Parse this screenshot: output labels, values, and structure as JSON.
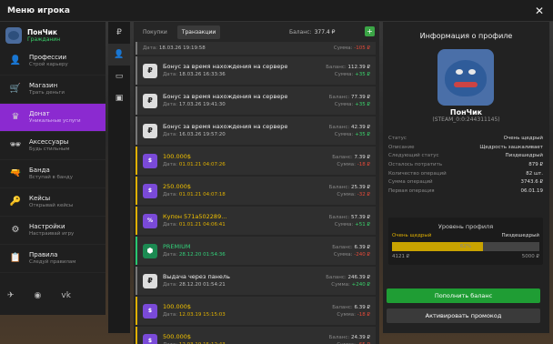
{
  "window": {
    "title": "Меню игрока",
    "close_symbol": "✕"
  },
  "player": {
    "name": "ПонЧик",
    "role": "Гражданин"
  },
  "sidebar": {
    "items": [
      {
        "icon": "person-icon",
        "glyph": "👤",
        "title": "Профессии",
        "subtitle": "Строй карьеру"
      },
      {
        "icon": "shop-icon",
        "glyph": "🛒",
        "title": "Магазин",
        "subtitle": "Трать деньги"
      },
      {
        "icon": "crown-icon",
        "glyph": "♛",
        "title": "Донат",
        "subtitle": "Уникальные услуги"
      },
      {
        "icon": "accessories-icon",
        "glyph": "🕶",
        "title": "Аксессуары",
        "subtitle": "Будь стильным"
      },
      {
        "icon": "gun-icon",
        "glyph": "🔫",
        "title": "Банда",
        "subtitle": "Вступай в банду"
      },
      {
        "icon": "key-icon",
        "glyph": "🔑",
        "title": "Кейсы",
        "subtitle": "Открывай кейсы"
      },
      {
        "icon": "settings-icon",
        "glyph": "⚙",
        "title": "Настройки",
        "subtitle": "Настраивай игру"
      },
      {
        "icon": "rules-icon",
        "glyph": "📋",
        "title": "Правила",
        "subtitle": "Следуй правилам"
      }
    ],
    "socials": [
      {
        "icon": "telegram-icon",
        "glyph": "✈"
      },
      {
        "icon": "discord-icon",
        "glyph": "◉"
      },
      {
        "icon": "vk-icon",
        "glyph": "vk"
      }
    ]
  },
  "icon_column": [
    {
      "icon": "ruble-icon",
      "glyph": "₽"
    },
    {
      "icon": "user-icon",
      "glyph": "👤"
    },
    {
      "icon": "car-icon",
      "glyph": "▭"
    },
    {
      "icon": "box-icon",
      "glyph": "▣"
    }
  ],
  "tabs": [
    "Покупки",
    "Транзакции"
  ],
  "balance": {
    "label": "Баланс:",
    "value": "377.4 ₽",
    "add_symbol": "+"
  },
  "transactions": [
    {
      "kind": "normal",
      "glyph": "₽",
      "title": "",
      "date": "18.03.26 19:19:58",
      "balance": "",
      "sum": "-105 ₽",
      "sign": "neg"
    },
    {
      "kind": "normal",
      "glyph": "₽",
      "title": "Бонус за время нахождения на сервере",
      "date": "18.03.26 16:33:36",
      "balance": "112.39 ₽",
      "sum": "+35 ₽",
      "sign": "pos"
    },
    {
      "kind": "normal",
      "glyph": "₽",
      "title": "Бонус за время нахождения на сервере",
      "date": "17.03.26 19:41:30",
      "balance": "77.39 ₽",
      "sum": "+35 ₽",
      "sign": "pos"
    },
    {
      "kind": "normal",
      "glyph": "₽",
      "title": "Бонус за время нахождения на сервере",
      "date": "16.03.26 19:57:20",
      "balance": "42.39 ₽",
      "sum": "+35 ₽",
      "sign": "pos"
    },
    {
      "kind": "gold",
      "glyph": "$",
      "title": "100.000$",
      "date": "01.01.21 04:07:26",
      "balance": "7.39 ₽",
      "sum": "-18 ₽",
      "sign": "neg"
    },
    {
      "kind": "gold",
      "glyph": "$",
      "title": "250.000$",
      "date": "01.01.21 04:07:18",
      "balance": "25.39 ₽",
      "sum": "-32 ₽",
      "sign": "neg"
    },
    {
      "kind": "gold",
      "glyph": "%",
      "title": "Купон 571a502289...",
      "date": "01.01.21 04:06:41",
      "balance": "57.39 ₽",
      "sum": "+51 ₽",
      "sign": "pos"
    },
    {
      "kind": "green",
      "glyph": "⬢",
      "title": "PREMIUM",
      "date": "28.12.20 01:54:36",
      "balance": "6.39 ₽",
      "sum": "-240 ₽",
      "sign": "neg"
    },
    {
      "kind": "normal",
      "glyph": "₽",
      "title": "Выдача через панель",
      "date": "28.12.20 01:54:21",
      "balance": "246.39 ₽",
      "sum": "+240 ₽",
      "sign": "pos"
    },
    {
      "kind": "gold",
      "glyph": "$",
      "title": "100.000$",
      "date": "12.03.19 15:15:03",
      "balance": "6.39 ₽",
      "sum": "-18 ₽",
      "sign": "neg"
    },
    {
      "kind": "gold",
      "glyph": "$",
      "title": "500.000$",
      "date": "12.03.19 15:12:43",
      "balance": "24.39 ₽",
      "sum": "-65 ₽",
      "sign": "neg"
    }
  ],
  "row_labels": {
    "date": "Дата:",
    "balance": "Баланс:",
    "sum": "Сумма:"
  },
  "profile_panel": {
    "title": "Информация о профиле",
    "name": "ПонЧик",
    "steam": "(STEAM_0:0:244311145)",
    "stats": [
      {
        "k": "Статус",
        "v": "Очень щедрый"
      },
      {
        "k": "Описание",
        "v": "Щедрость зашкаливает"
      },
      {
        "k": "Следующий статус",
        "v": "Пиздешедрый"
      },
      {
        "k": "Осталось потратить",
        "v": "879 ₽"
      },
      {
        "k": "Количество операций",
        "v": "82 шт."
      },
      {
        "k": "Сумма операций",
        "v": "3743.6 ₽"
      },
      {
        "k": "Первая операция",
        "v": "06.01.19"
      }
    ],
    "level": {
      "title": "Уровень профиля",
      "current": "Очень щедрый",
      "next": "Пиздешедрый",
      "progress_percent": 62,
      "progress_label": "62%",
      "min": "4121 ₽",
      "max": "5000 ₽"
    },
    "buttons": {
      "topup": "Пополнить баланс",
      "promo": "Активировать промокод"
    }
  },
  "colors": {
    "accent": "#8b2ad0",
    "positive": "#3ad06a",
    "negative": "#e34a3a",
    "gold": "#e0b000",
    "button_green": "#1f9d34"
  }
}
